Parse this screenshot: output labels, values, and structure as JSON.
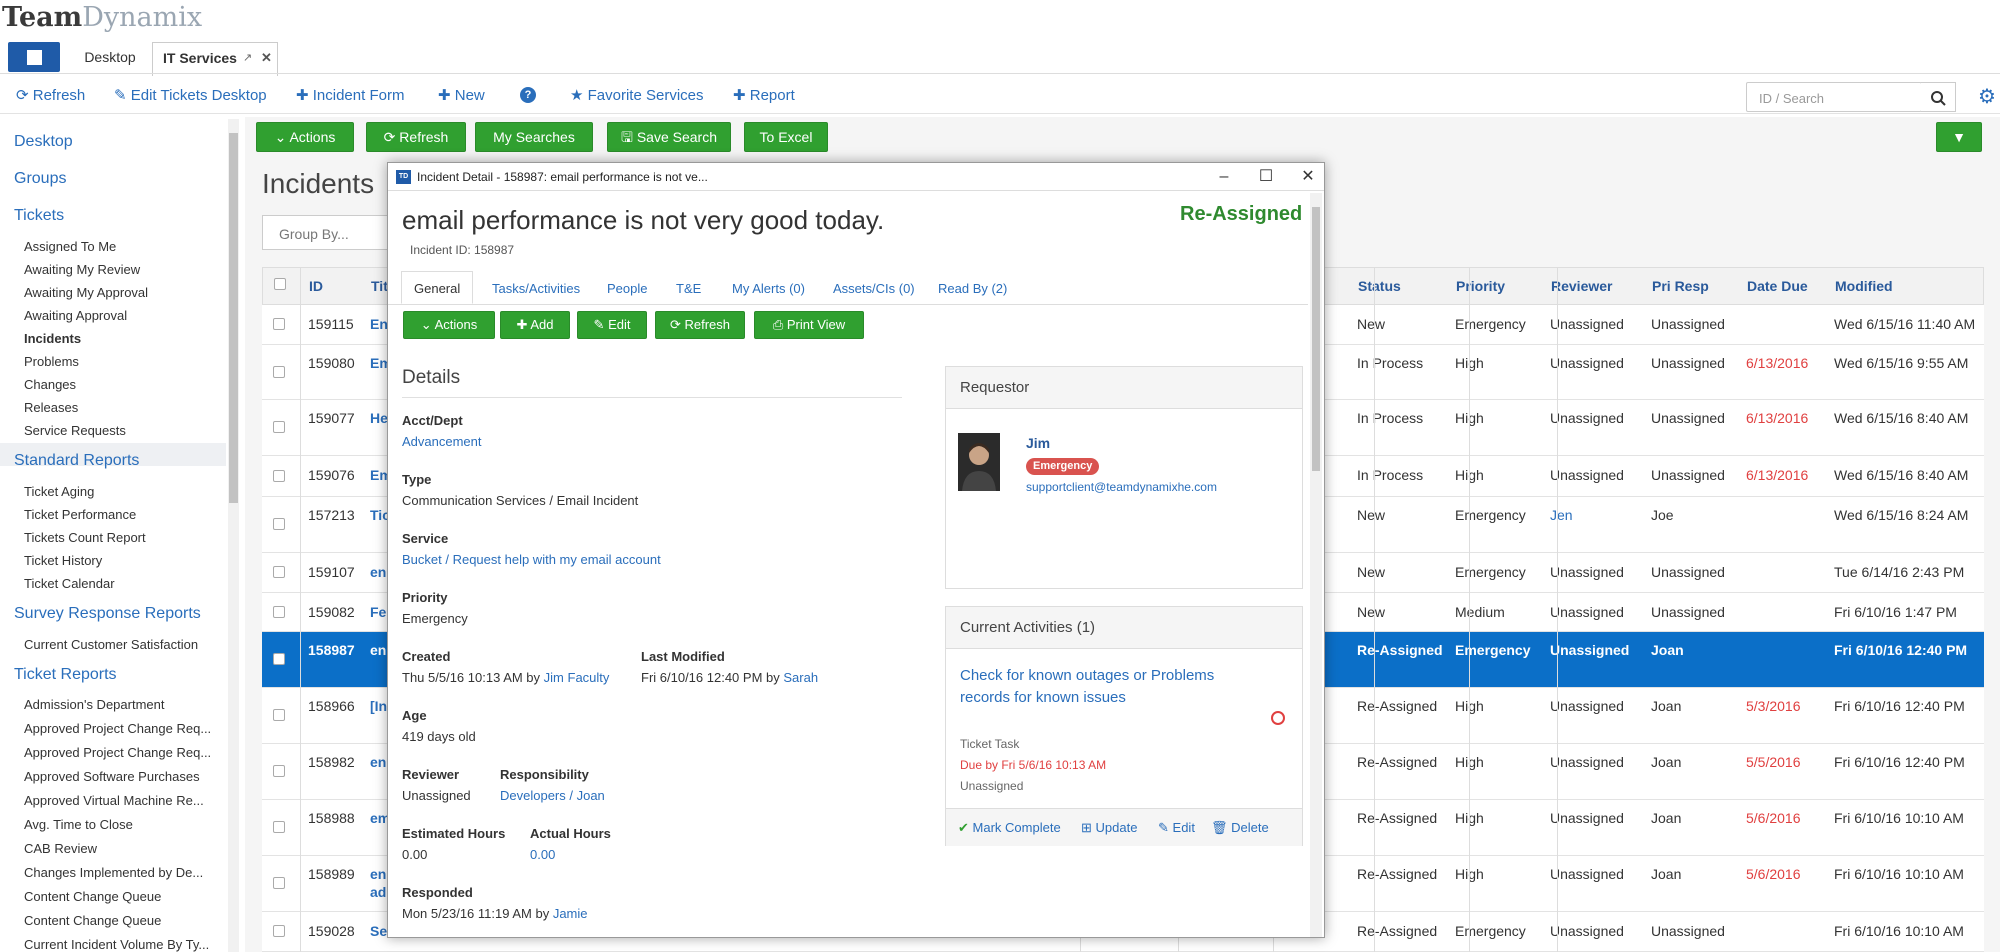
{
  "app": {
    "logo_team": "Team",
    "logo_dynamix": "Dynamix"
  },
  "tabs": [
    {
      "label": "Desktop"
    },
    {
      "label": "IT Services"
    }
  ],
  "toolbar": {
    "refresh": "Refresh",
    "edit_desktop": "Edit Tickets Desktop",
    "incident_form": "Incident Form",
    "new": "New",
    "favorite_services": "Favorite Services",
    "report": "Report",
    "search_placeholder": "ID / Search"
  },
  "sidebar": {
    "desktop": "Desktop",
    "groups": "Groups",
    "tickets": "Tickets",
    "ticket_items": [
      "Assigned To Me",
      "Awaiting My Review",
      "Awaiting My Approval",
      "Awaiting Approval",
      "Incidents",
      "Problems",
      "Changes",
      "Releases",
      "Service Requests"
    ],
    "standard_reports": "Standard Reports",
    "standard_items": [
      "Ticket Aging",
      "Ticket Performance",
      "Tickets Count Report",
      "Ticket History",
      "Ticket Calendar"
    ],
    "survey_reports": "Survey Response Reports",
    "survey_items": [
      "Current Customer Satisfaction"
    ],
    "ticket_reports": "Ticket Reports",
    "report_items": [
      "Admission's Department",
      "Approved Project Change Req...",
      "Approved Project Change Req...",
      "Approved Software Purchases",
      "Approved Virtual Machine Re...",
      "Avg. Time to Close",
      "CAB Review",
      "Changes Implemented by De...",
      "Content Change Queue",
      "Content Change Queue",
      "Current Incident Volume By Ty..."
    ]
  },
  "actions": {
    "actions": "Actions",
    "refresh": "Refresh",
    "my_searches": "My Searches",
    "save_search": "Save Search",
    "to_excel": "To Excel"
  },
  "page": {
    "title": "Incidents",
    "group_by": "Group By..."
  },
  "table": {
    "headers": {
      "id": "ID",
      "title": "Tit",
      "status": "Status",
      "priority": "Priority",
      "reviewer": "Reviewer",
      "pri_resp": "Pri Resp",
      "date_due": "Date Due",
      "modified": "Modified"
    },
    "rows": [
      {
        "id": "159115",
        "title": "En",
        "status": "New",
        "priority": "Emergency",
        "reviewer": "Unassigned",
        "pri_resp": "Unassigned",
        "date_due": "",
        "modified": "Wed 6/15/16 11:40 AM"
      },
      {
        "id": "159080",
        "title": "Em",
        "status": "In Process",
        "priority": "High",
        "reviewer": "Unassigned",
        "pri_resp": "Unassigned",
        "date_due": "6/13/2016",
        "modified": "Wed 6/15/16 9:55 AM"
      },
      {
        "id": "159077",
        "title": "He",
        "status": "In Process",
        "priority": "High",
        "reviewer": "Unassigned",
        "pri_resp": "Unassigned",
        "date_due": "6/13/2016",
        "modified": "Wed 6/15/16 8:40 AM"
      },
      {
        "id": "159076",
        "title": "Em",
        "status": "In Process",
        "priority": "High",
        "reviewer": "Unassigned",
        "pri_resp": "Unassigned",
        "date_due": "6/13/2016",
        "modified": "Wed 6/15/16 8:40 AM"
      },
      {
        "id": "157213",
        "title": "Tic",
        "status": "New",
        "priority": "Emergency",
        "reviewer": "Jen",
        "pri_resp": "Joe",
        "date_due": "",
        "modified": "Wed 6/15/16 8:24 AM"
      },
      {
        "id": "159107",
        "title": "en",
        "status": "New",
        "priority": "Emergency",
        "reviewer": "Unassigned",
        "pri_resp": "Unassigned",
        "date_due": "",
        "modified": "Tue 6/14/16 2:43 PM"
      },
      {
        "id": "159082",
        "title": "Fe",
        "status": "New",
        "priority": "Medium",
        "reviewer": "Unassigned",
        "pri_resp": "Unassigned",
        "date_due": "",
        "modified": "Fri 6/10/16 1:47 PM"
      },
      {
        "id": "158987",
        "title": "en",
        "status": "Re-Assigned",
        "priority": "Emergency",
        "reviewer": "Unassigned",
        "pri_resp": "Joan",
        "date_due": "",
        "modified": "Fri 6/10/16 12:40 PM"
      },
      {
        "id": "158966",
        "title": "[In",
        "status": "Re-Assigned",
        "priority": "High",
        "reviewer": "Unassigned",
        "pri_resp": "Joan",
        "date_due": "5/3/2016",
        "modified": "Fri 6/10/16 12:40 PM"
      },
      {
        "id": "158982",
        "title": "en",
        "status": "Re-Assigned",
        "priority": "High",
        "reviewer": "Unassigned",
        "pri_resp": "Joan",
        "date_due": "5/5/2016",
        "modified": "Fri 6/10/16 12:40 PM"
      },
      {
        "id": "158988",
        "title": "em",
        "status": "Re-Assigned",
        "priority": "High",
        "reviewer": "Unassigned",
        "pri_resp": "Joan",
        "date_due": "5/6/2016",
        "modified": "Fri 6/10/16 10:10 AM"
      },
      {
        "id": "158989",
        "title": "en",
        "title2": "ad",
        "status": "Re-Assigned",
        "priority": "High",
        "reviewer": "Unassigned",
        "pri_resp": "Joan",
        "date_due": "5/6/2016",
        "modified": "Fri 6/10/16 10:10 AM"
      },
      {
        "id": "159028",
        "title": "Se",
        "status": "Re-Assigned",
        "priority": "Emergency",
        "reviewer": "Unassigned",
        "pri_resp": "Unassigned",
        "date_due": "",
        "modified": "Fri 6/10/16 10:10 AM"
      }
    ]
  },
  "modal": {
    "window_title": "Incident Detail - 158987: email performance is not ve...",
    "td_badge": "TD",
    "title": "email performance is not very good today.",
    "incident_id": "Incident ID: 158987",
    "status": "Re-Assigned",
    "tabs": [
      "General",
      "Tasks/Activities",
      "People",
      "T&E",
      "My Alerts (0)",
      "Assets/CIs (0)",
      "Read By (2)"
    ],
    "buttons": {
      "actions": "Actions",
      "add": "Add",
      "edit": "Edit",
      "refresh": "Refresh",
      "print_view": "Print View"
    },
    "details_heading": "Details",
    "fields": {
      "acct_label": "Acct/Dept",
      "acct": "Advancement",
      "type_label": "Type",
      "type": "Communication Services / Email Incident",
      "service_label": "Service",
      "service": "Bucket / Request help with my email account",
      "priority_label": "Priority",
      "priority": "Emergency",
      "created_label": "Created",
      "created": "Thu 5/5/16 10:13 AM by",
      "created_by": "Jim Faculty",
      "modified_label": "Last Modified",
      "modified": "Fri 6/10/16 12:40 PM by",
      "modified_by": "Sarah",
      "age_label": "Age",
      "age": "419 days old",
      "reviewer_label": "Reviewer",
      "reviewer": "Unassigned",
      "resp_label": "Responsibility",
      "resp": "Developers / Joan",
      "est_label": "Estimated Hours",
      "est": "0.00",
      "act_label": "Actual Hours",
      "act": "0.00",
      "responded_label": "Responded",
      "responded": "Mon 5/23/16 11:19 AM by",
      "responded_by": "Jamie"
    },
    "requestor": {
      "heading": "Requestor",
      "name": "Jim",
      "badge": "Emergency",
      "email": "supportclient@teamdynamixhe.com"
    },
    "activities": {
      "heading": "Current Activities (1)",
      "task_title": "Check for known outages or Problems records for known issues",
      "kind": "Ticket Task",
      "due": "Due by Fri 5/6/16 10:13 AM",
      "assignee": "Unassigned",
      "mark_complete": "Mark Complete",
      "update": "Update",
      "edit": "Edit",
      "delete": "Delete"
    }
  },
  "colors": {
    "green": "#30a030",
    "brand_blue": "#1f5ba8",
    "link": "#2a6ebb",
    "selected_row": "#0b6fc8",
    "overdue": "#e04040",
    "badge_red": "#d9534f"
  }
}
